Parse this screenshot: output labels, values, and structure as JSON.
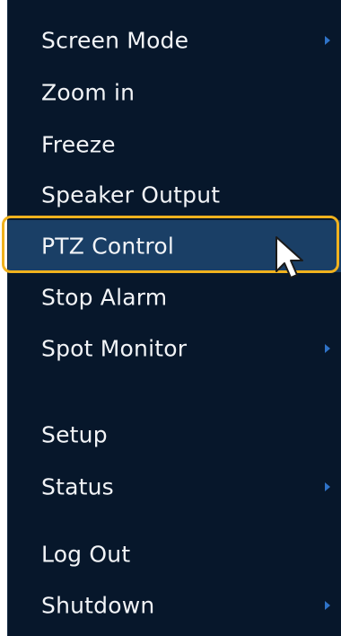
{
  "menu": {
    "items": [
      {
        "label": "Screen Mode",
        "has_submenu": true
      },
      {
        "label": "Zoom in",
        "has_submenu": false
      },
      {
        "label": "Freeze",
        "has_submenu": false
      },
      {
        "label": "Speaker Output",
        "has_submenu": false
      },
      {
        "label": "PTZ Control",
        "has_submenu": false,
        "highlighted": true
      },
      {
        "label": "Stop Alarm",
        "has_submenu": false
      },
      {
        "label": "Spot Monitor",
        "has_submenu": true
      },
      {
        "label": "Setup",
        "has_submenu": false
      },
      {
        "label": "Status",
        "has_submenu": true
      },
      {
        "label": "Log Out",
        "has_submenu": false
      },
      {
        "label": "Shutdown",
        "has_submenu": true
      }
    ]
  },
  "colors": {
    "menu_background": "#07172b",
    "highlight_background": "#1a3f66",
    "highlight_ring": "#f0b21e",
    "text": "#f2f4f7",
    "submenu_arrow": "#2f73c8"
  },
  "cursor": {
    "icon": "mouse-pointer-icon"
  }
}
